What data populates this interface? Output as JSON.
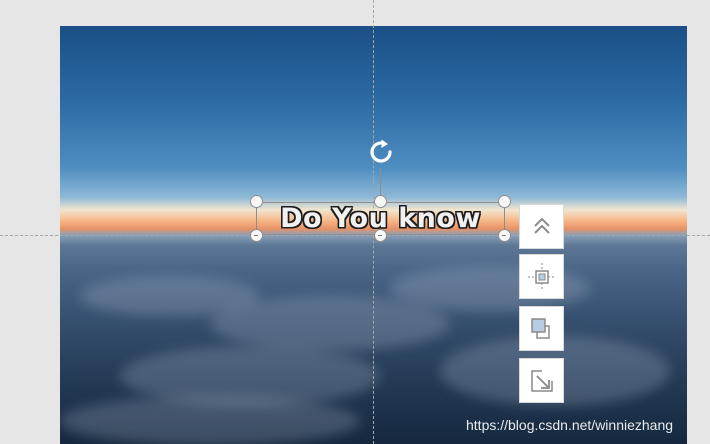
{
  "canvas": {
    "text_object": {
      "text": "Do You know"
    }
  },
  "toolbar": {
    "buttons": [
      {
        "icon": "bring-to-front-icon"
      },
      {
        "icon": "center-align-icon"
      },
      {
        "icon": "layer-copy-icon"
      },
      {
        "icon": "resize-icon"
      }
    ]
  },
  "watermark": "https://blog.csdn.net/winniezhang",
  "colors": {
    "workspace": "#e6e6e6",
    "toolbar_icon": "#8a8a8a",
    "layer_fill": "#b7cde4",
    "selection_border": "#8e8e8e"
  }
}
